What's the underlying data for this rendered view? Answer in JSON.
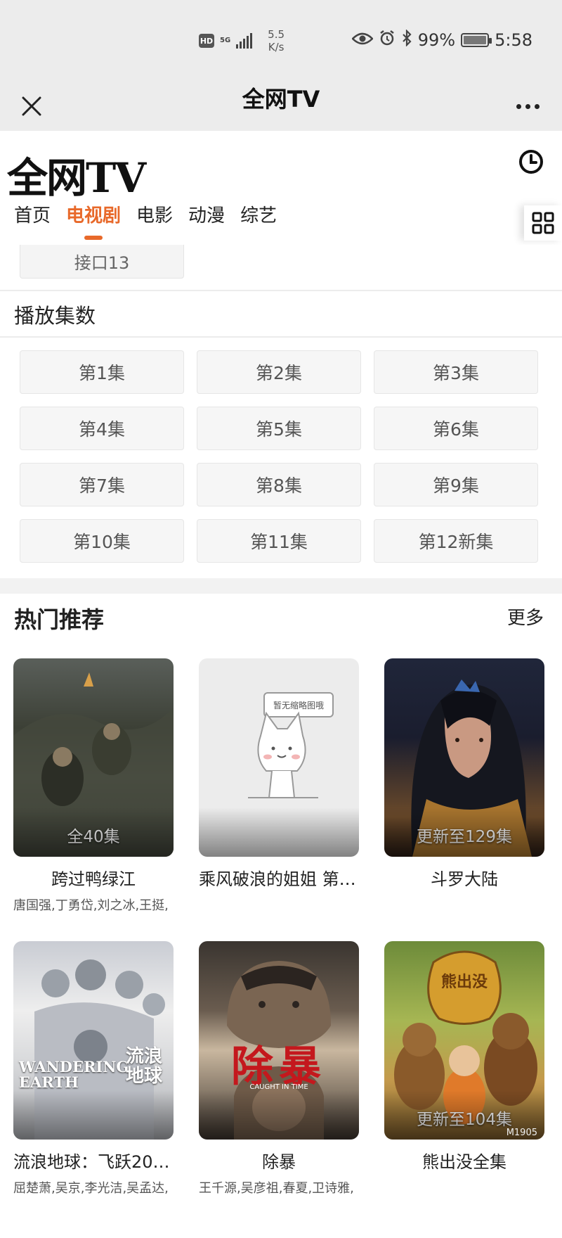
{
  "status_bar": {
    "hd": "HD",
    "network": "5G",
    "speed_value": "5.5",
    "speed_unit": "K/s",
    "battery": "99%",
    "battery_level": 0.99,
    "time": "5:58"
  },
  "nav": {
    "title": "全网TV"
  },
  "header": {
    "logo": "全网TV",
    "tabs": [
      "首页",
      "电视剧",
      "电影",
      "动漫",
      "综艺"
    ],
    "active_tab": "电视剧"
  },
  "source": {
    "label": "接口13"
  },
  "episodes": {
    "title": "播放集数",
    "items": [
      "第1集",
      "第2集",
      "第3集",
      "第4集",
      "第5集",
      "第6集",
      "第7集",
      "第8集",
      "第9集",
      "第10集",
      "第11集",
      "第12新集"
    ]
  },
  "hot": {
    "title": "热门推荐",
    "more": "更多",
    "cards": [
      {
        "title": "跨过鸭绿江",
        "badge": "全40集",
        "cast": "唐国强,丁勇岱,刘之冰,王挺,"
      },
      {
        "title": "乘风破浪的姐姐 第…",
        "badge": "",
        "placeholder_text": "暂无缩略图哦",
        "cast": ""
      },
      {
        "title": "斗罗大陆",
        "badge": "更新至129集",
        "cast": ""
      },
      {
        "title": "流浪地球：飞跃20…",
        "badge": "",
        "cast": "屈楚萧,吴京,李光洁,吴孟达,"
      },
      {
        "title": "除暴",
        "badge": "",
        "cast": "王千源,吴彦祖,春夏,卫诗雅,"
      },
      {
        "title": "熊出没全集",
        "badge": "更新至104集",
        "cast": ""
      }
    ],
    "poster_texts": {
      "wandering_earth": "WANDERING EARTH",
      "wandering_earth_cn": "流浪地球",
      "chubao": "除暴",
      "chubao_en": "CAUGHT IN TIME",
      "xiongchumo": "熊出没",
      "m1905": "M1905"
    }
  },
  "colors": {
    "accent": "#e8692a",
    "bar_bg": "#ececec"
  }
}
